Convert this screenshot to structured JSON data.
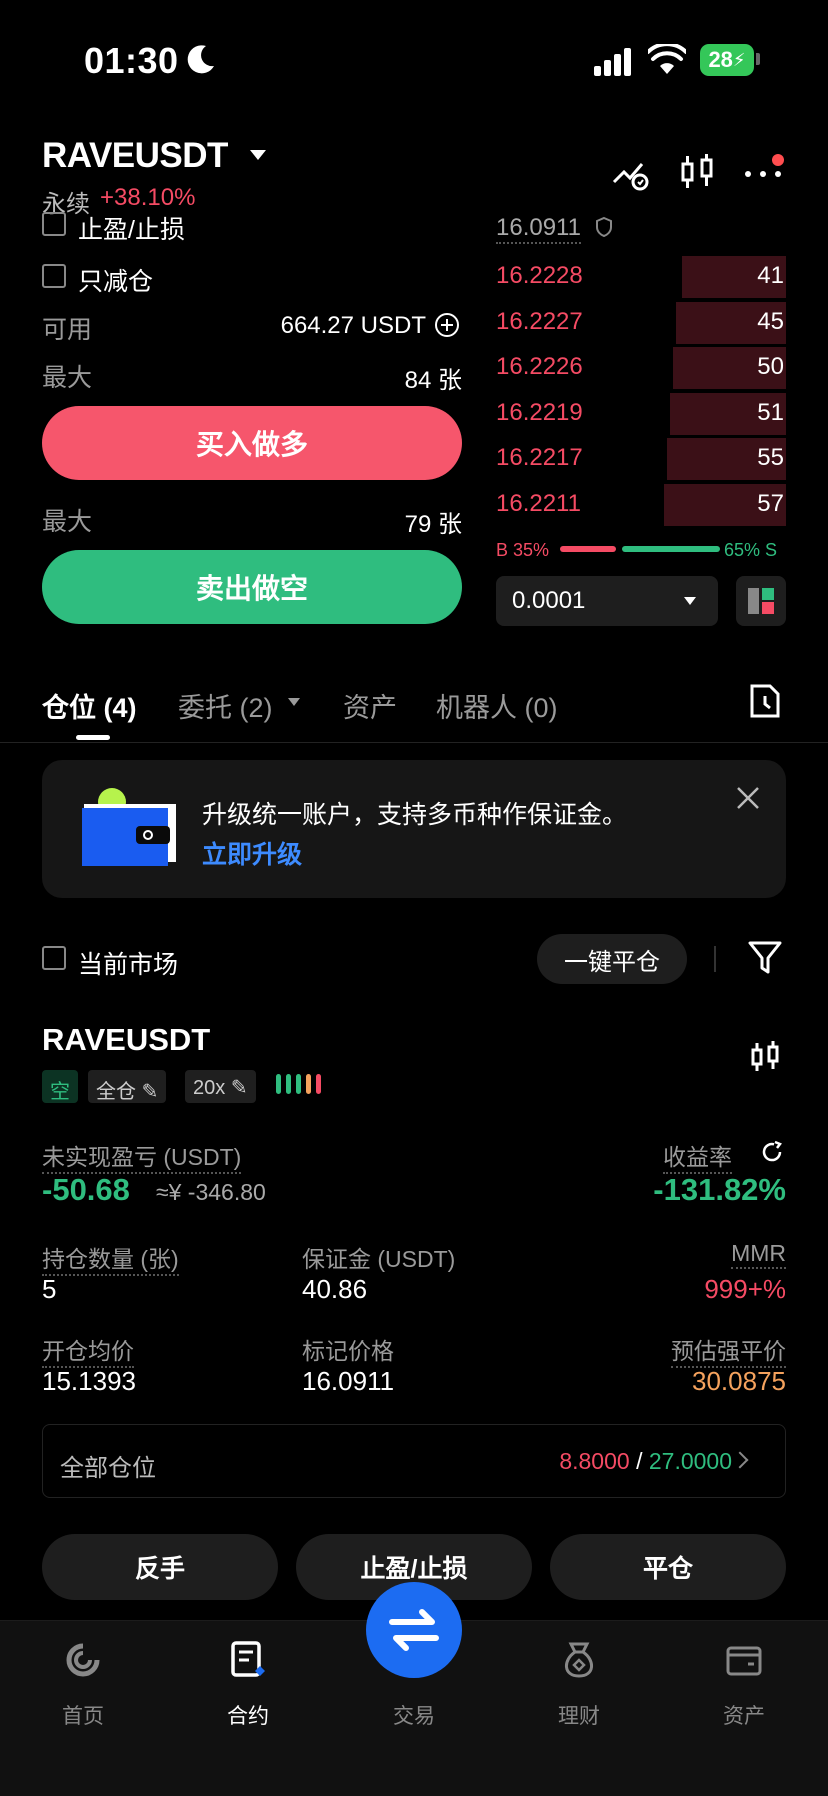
{
  "status_bar": {
    "time": "01:30",
    "battery": "28"
  },
  "header": {
    "symbol": "RAVEUSDT",
    "contract_type": "永续",
    "change": "+38.10%"
  },
  "form": {
    "tpsl_label": "止盈/止损",
    "reduce_only_label": "只减仓",
    "available_label": "可用",
    "available_value": "664.27 USDT",
    "max_label": "最大",
    "max_long": "84 张",
    "buy_label": "买入做多",
    "max_short": "79 张",
    "sell_label": "卖出做空"
  },
  "orderbook": {
    "mark_price": "16.0911",
    "asks": [
      {
        "price": "16.2228",
        "qty": "41",
        "depth": 0.36
      },
      {
        "price": "16.2227",
        "qty": "45",
        "depth": 0.38
      },
      {
        "price": "16.2226",
        "qty": "50",
        "depth": 0.39
      },
      {
        "price": "16.2219",
        "qty": "51",
        "depth": 0.4
      },
      {
        "price": "16.2217",
        "qty": "55",
        "depth": 0.41
      },
      {
        "price": "16.2211",
        "qty": "57",
        "depth": 0.42
      }
    ],
    "buy_ratio": "B 35%",
    "sell_ratio": "65% S",
    "precision": "0.0001"
  },
  "tabs": [
    {
      "label": "仓位 (4)"
    },
    {
      "label": "委托 (2)"
    },
    {
      "label": "资产"
    },
    {
      "label": "机器人 (0)"
    }
  ],
  "banner": {
    "text": "升级统一账户，支持多币种作保证金。",
    "link": "立即升级"
  },
  "filter": {
    "current_market": "当前市场",
    "close_all": "一键平仓"
  },
  "position": {
    "symbol": "RAVEUSDT",
    "side_tag": "空",
    "margin_mode": "全仓",
    "leverage": "20x",
    "upnl_label": "未实现盈亏 (USDT)",
    "upnl_value": "-50.68",
    "upnl_cny": "≈¥ -346.80",
    "roe_label": "收益率",
    "roe_value": "-131.82%",
    "size_label": "持仓数量 (张)",
    "size_value": "5",
    "margin_label": "保证金 (USDT)",
    "margin_value": "40.86",
    "mmr_label": "MMR",
    "mmr_value": "999+%",
    "entry_label": "开仓均价",
    "entry_value": "15.1393",
    "mark_label": "标记价格",
    "mark_value": "16.0911",
    "liq_label": "预估强平价",
    "liq_value": "30.0875",
    "all_positions_label": "全部仓位",
    "tp_value": "8.8000",
    "sl_value": "27.0000",
    "reverse_label": "反手",
    "tpsl_label": "止盈/止损",
    "close_label": "平仓"
  },
  "nav": [
    {
      "label": "首页",
      "icon": "home-icon"
    },
    {
      "label": "合约",
      "icon": "futures-icon"
    },
    {
      "label": "交易",
      "icon": "swap-icon"
    },
    {
      "label": "理财",
      "icon": "earn-icon"
    },
    {
      "label": "资产",
      "icon": "wallet-icon"
    }
  ],
  "colors": {
    "red": "#f54b64",
    "green": "#2fbd7f",
    "blue": "#1c6cf2",
    "orange": "#f5a25d"
  }
}
